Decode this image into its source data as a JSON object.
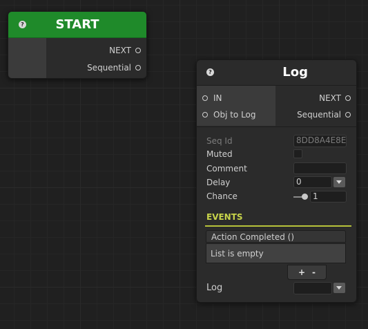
{
  "start_node": {
    "help_icon": "?",
    "title": "START",
    "outputs": [
      "NEXT",
      "Sequential"
    ]
  },
  "log_node": {
    "help_icon": "?",
    "title": "Log",
    "inputs": [
      "IN",
      "Obj to Log"
    ],
    "outputs": [
      "NEXT",
      "Sequential"
    ],
    "properties": {
      "seq_id_label": "Seq Id",
      "seq_id_value": "8DD8A4E8E",
      "muted_label": "Muted",
      "comment_label": "Comment",
      "comment_value": "",
      "delay_label": "Delay",
      "delay_value": "0",
      "chance_label": "Chance",
      "chance_value": "1"
    },
    "events": {
      "label": "EVENTS",
      "list_header": "Action Completed ()",
      "empty_text": "List is empty",
      "add_label": "+",
      "remove_label": "-"
    },
    "log_label": "Log",
    "log_value": ""
  },
  "colors": {
    "start_header": "#1f8a2a",
    "events_accent": "#b7c23a",
    "background": "#202020"
  }
}
